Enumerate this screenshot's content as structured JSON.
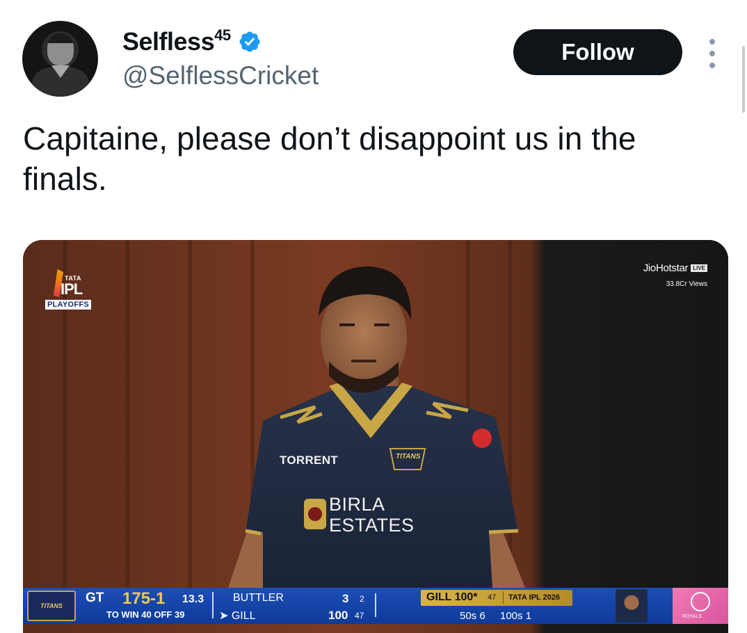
{
  "author": {
    "display_name": "Selfless",
    "name_superscript": "45",
    "handle": "@SelflessCricket",
    "verified_icon": "verified-badge-icon",
    "accent_color": "#1d9bf0"
  },
  "actions": {
    "follow_label": "Follow",
    "more_icon": "more-vertical-icon"
  },
  "tweet": {
    "text": "Capitaine, please don’t disappoint us in the finals."
  },
  "media": {
    "broadcast": {
      "ipl_logo": {
        "tata": "TATA",
        "ipl": "IPL",
        "playoffs": "PLAYOFFS"
      },
      "jio": {
        "brand": "JioHotstar",
        "live_badge": "LIVE",
        "views": "33.8Cr Views"
      },
      "jersey": {
        "sponsor_chest": "TORRENT",
        "sponsor_main_line1": "BIRLA",
        "sponsor_main_line2": "ESTATES",
        "team_badge": "TITANS"
      }
    },
    "scoreboard": {
      "team_badge": "TITANS",
      "team": "GT",
      "score": "175-1",
      "overs": "13.3",
      "target": "TO WIN 40 OFF 39",
      "batter1_name": "BUTTLER",
      "batter1_runs": "3",
      "batter1_balls": "2",
      "batter2_name": "➤ GILL",
      "batter2_runs": "100",
      "batter2_balls": "47",
      "milestone_name": "GILL 100*",
      "milestone_balls": "47",
      "milestone_tag": "TATA IPL 2026",
      "fifties": "50s 6",
      "hundreds": "100s 1",
      "opponent_label": "ROYALS"
    }
  }
}
